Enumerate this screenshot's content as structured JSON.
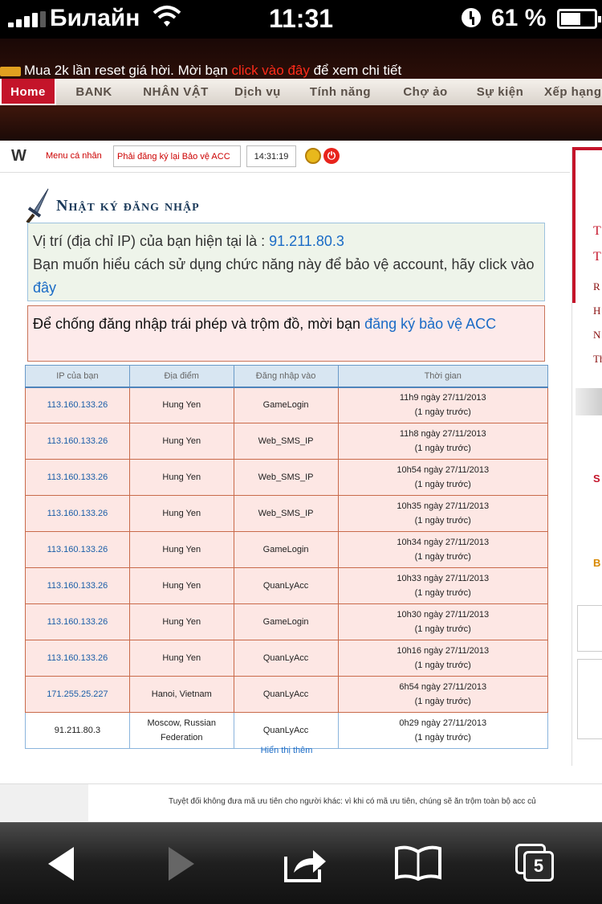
{
  "status_bar": {
    "carrier": "Билайн",
    "time": "11:31",
    "battery": "61 %"
  },
  "site": {
    "marquee": {
      "text_before": "Mua 2k lần reset giá hời. Mời bạn ",
      "link": "click vào đây",
      "text_after": " để xem chi tiết"
    },
    "nav": [
      {
        "label": "Home",
        "active": true
      },
      {
        "label": "BANK",
        "active": false
      },
      {
        "label": "NHÂN VẬT",
        "active": false
      },
      {
        "label": "Dịch vụ",
        "active": false
      },
      {
        "label": "Tính năng",
        "active": false
      },
      {
        "label": "Chợ ảo",
        "active": false
      },
      {
        "label": "Sự kiện",
        "active": false
      },
      {
        "label": "Xếp hạng",
        "active": false
      }
    ]
  },
  "topbar": {
    "logo": "W",
    "menu": "Menu cá nhân",
    "warning": "Phải đăng ký lại Bảo vệ ACC",
    "time": "14:31:19"
  },
  "section": {
    "title": "Nhật ký đăng nhập",
    "ip_line_label": "Vị trí (địa chỉ IP) của bạn hiện tại là : ",
    "ip_value": "91.211.80.3",
    "help_text": "Bạn muốn hiểu cách sử dụng chức năng này để bảo vệ account, hãy click vào ",
    "help_link": "đây",
    "warn_text": "Để chống đăng nhập trái phép và trộm đồ, mời bạn ",
    "warn_link": "đăng ký bảo vệ ACC"
  },
  "table": {
    "headers": [
      "IP của bạn",
      "Địa điểm",
      "Đăng nhập vào",
      "Thời gian"
    ],
    "rows": [
      {
        "ip": "113.160.133.26",
        "location": "Hung Yen",
        "target": "GameLogin",
        "time": "11h9 ngày 27/11/2013",
        "ago": "(1 ngày trước)"
      },
      {
        "ip": "113.160.133.26",
        "location": "Hung Yen",
        "target": "Web_SMS_IP",
        "time": "11h8 ngày 27/11/2013",
        "ago": "(1 ngày trước)"
      },
      {
        "ip": "113.160.133.26",
        "location": "Hung Yen",
        "target": "Web_SMS_IP",
        "time": "10h54 ngày 27/11/2013",
        "ago": "(1 ngày trước)"
      },
      {
        "ip": "113.160.133.26",
        "location": "Hung Yen",
        "target": "Web_SMS_IP",
        "time": "10h35 ngày 27/11/2013",
        "ago": "(1 ngày trước)"
      },
      {
        "ip": "113.160.133.26",
        "location": "Hung Yen",
        "target": "GameLogin",
        "time": "10h34 ngày 27/11/2013",
        "ago": "(1 ngày trước)"
      },
      {
        "ip": "113.160.133.26",
        "location": "Hung Yen",
        "target": "QuanLyAcc",
        "time": "10h33 ngày 27/11/2013",
        "ago": "(1 ngày trước)"
      },
      {
        "ip": "113.160.133.26",
        "location": "Hung Yen",
        "target": "GameLogin",
        "time": "10h30 ngày 27/11/2013",
        "ago": "(1 ngày trước)"
      },
      {
        "ip": "113.160.133.26",
        "location": "Hung Yen",
        "target": "QuanLyAcc",
        "time": "10h16 ngày 27/11/2013",
        "ago": "(1 ngày trước)"
      },
      {
        "ip": "171.255.25.227",
        "location": "Hanoi, Vietnam",
        "target": "QuanLyAcc",
        "time": "6h54 ngày 27/11/2013",
        "ago": "(1 ngày trước)"
      },
      {
        "ip": "91.211.80.3",
        "location": "Moscow, Russian Federation",
        "target": "QuanLyAcc",
        "time": "0h29 ngày 27/11/2013",
        "ago": "(1 ngày trước)"
      }
    ],
    "more": "Hiển thị thêm"
  },
  "footer": {
    "text": "Tuyệt đối không đưa mã ưu tiên cho người khác: vì khi có mã ưu tiên, chúng sẽ ăn trộm toàn bộ acc củ"
  },
  "right_panel": {
    "letters": [
      "T",
      "T",
      "R",
      "H",
      "N",
      "Th"
    ],
    "s": "S",
    "b": "B"
  },
  "toolbar": {
    "tabs_count": "5"
  }
}
